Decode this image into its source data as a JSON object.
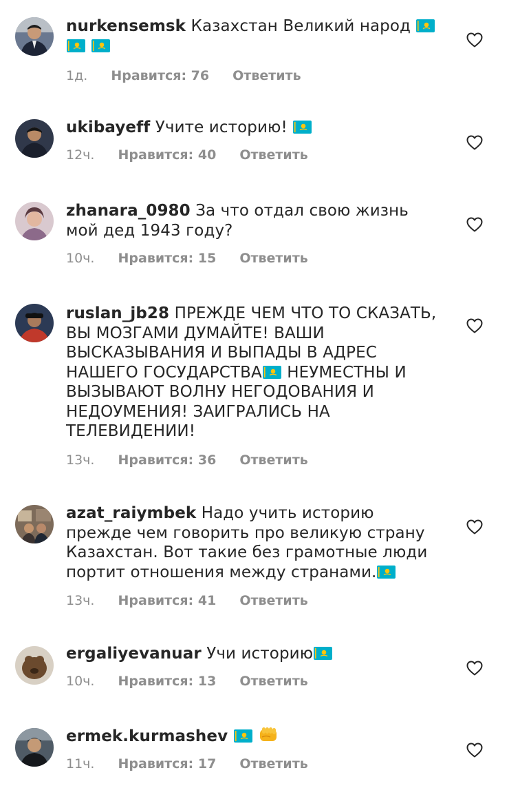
{
  "comments": [
    {
      "username": "nurkensemsk",
      "text": "Казахстан Великий народ",
      "time": "1д.",
      "likes": "Нравится: 76",
      "reply": "Ответить"
    },
    {
      "username": "ukibayeff",
      "text": "Учите историю!",
      "time": "12ч.",
      "likes": "Нравится: 40",
      "reply": "Ответить"
    },
    {
      "username": "zhanara_0980",
      "text": "За что отдал свою жизнь мой дед 1943 году?",
      "time": "10ч.",
      "likes": "Нравится: 15",
      "reply": "Ответить"
    },
    {
      "username": "ruslan_jb28",
      "text": "ПРЕЖДЕ ЧЕМ ЧТО ТО СКАЗАТЬ, ВЫ МОЗГАМИ ДУМАЙТЕ! ВАШИ ВЫСКАЗЫВАНИЯ И ВЫПАДЫ В АДРЕС НАШЕГО ГОСУДАРСТВА",
      "text2": "НЕУМЕСТНЫ И ВЫЗЫВАЮТ ВОЛНУ НЕГОДОВАНИЯ И НЕДОУМЕНИЯ! ЗАИГРАЛИСЬ НА ТЕЛЕВИДЕНИИ!",
      "time": "13ч.",
      "likes": "Нравится: 36",
      "reply": "Ответить"
    },
    {
      "username": "azat_raiymbek",
      "text": "Надо учить историю прежде чем говорить про великую страну Казахстан. Вот такие без грамотные люди портит отношения между странами.",
      "time": "13ч.",
      "likes": "Нравится: 41",
      "reply": "Ответить"
    },
    {
      "username": "ergaliyevanuar",
      "text": "Учи историю",
      "time": "10ч.",
      "likes": "Нравится: 13",
      "reply": "Ответить"
    },
    {
      "username": "ermek.kurmashev",
      "text": "",
      "time": "11ч.",
      "likes": "Нравится: 17",
      "reply": "Ответить"
    }
  ],
  "icons": {
    "like": "heart-outline-icon",
    "flag": "kazakhstan-flag-emoji",
    "fist": "oncoming-fist-emoji"
  },
  "colors": {
    "text": "#262626",
    "meta": "#8e8e8e",
    "flag_blue": "#00afca",
    "flag_gold": "#fec50c"
  }
}
